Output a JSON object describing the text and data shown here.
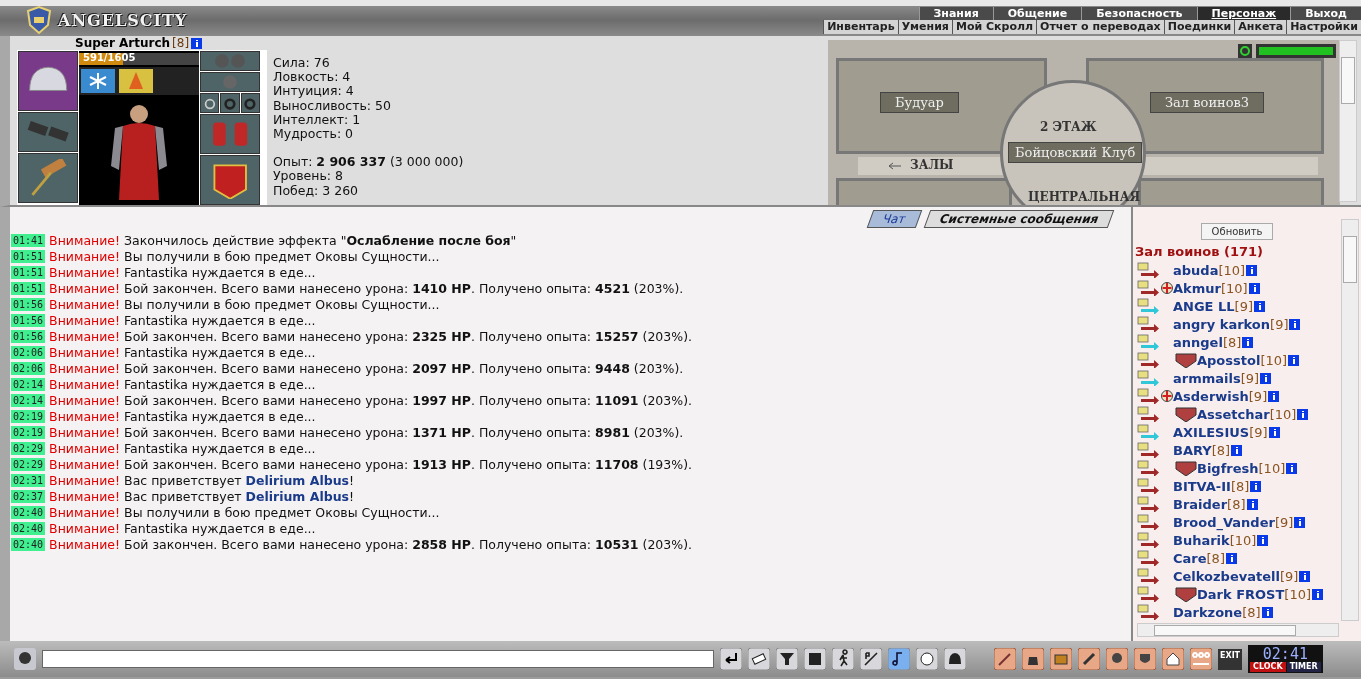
{
  "top_menu": {
    "logo": "ANGELSCITY",
    "primary": [
      {
        "label": "Знания",
        "selected": false
      },
      {
        "label": "Общение",
        "selected": false
      },
      {
        "label": "Безопасность",
        "selected": false
      },
      {
        "label": "Персонаж",
        "selected": true
      },
      {
        "label": "Выход",
        "selected": false
      }
    ],
    "secondary": [
      "Инвентарь",
      "Умения",
      "Мой Скролл",
      "Отчет о переводах",
      "Поединки",
      "Анкета",
      "Настройки"
    ]
  },
  "character": {
    "name": "Super Arturch",
    "level": "[8]",
    "hp": {
      "text": "591/1605",
      "level": 0.37
    },
    "stats": [
      "Сила: 76",
      "Ловкость: 4",
      "Интуиция: 4",
      "Выносливость: 50",
      "Интеллект: 1",
      "Мудрость: 0"
    ],
    "progress": [
      "Опыт: **2 906 337** (3 000 000)",
      "Уровень: 8",
      "Побед: 3 260"
    ]
  },
  "map": {
    "rooms": [
      "Будуар",
      "Зал воинов3"
    ],
    "floor": "2 ЭТАЖ",
    "club": "Бойцовский Клуб",
    "exit": "ЗАЛЫ",
    "bottom": "ЦЕНТРАЛЬНАЯ"
  },
  "chat": {
    "tabs": [
      {
        "label": "Чат",
        "selected": true
      },
      {
        "label": "Системные сообщения",
        "selected": false
      }
    ],
    "messages": [
      {
        "time": "01:41",
        "label": "Внимание!",
        "kind": "info",
        "text": "Закончилось действие эффекта \"**Ослабление после боя**\""
      },
      {
        "time": "01:51",
        "label": "Внимание!",
        "kind": "info",
        "text": "Вы получили в бою предмет Оковы Сущности..."
      },
      {
        "time": "01:51",
        "label": "Внимание!",
        "kind": "info",
        "text": "Fantastika нуждается в еде..."
      },
      {
        "time": "01:51",
        "label": "Внимание!",
        "kind": "info",
        "text": "Бой закончен. Всего вами нанесено урона: **1410 HP**. Получено опыта: **4521** (203%)."
      },
      {
        "time": "01:56",
        "label": "Внимание!",
        "kind": "info",
        "text": "Вы получили в бою предмет Оковы Сущности..."
      },
      {
        "time": "01:56",
        "label": "Внимание!",
        "kind": "info",
        "text": "Fantastika нуждается в еде..."
      },
      {
        "time": "01:56",
        "label": "Внимание!",
        "kind": "info",
        "text": "Бой закончен. Всего вами нанесено урона: **2325 HP**. Получено опыта: **15257** (203%)."
      },
      {
        "time": "02:06",
        "label": "Внимание!",
        "kind": "info",
        "text": "Fantastika нуждается в еде..."
      },
      {
        "time": "02:06",
        "label": "Внимание!",
        "kind": "info",
        "text": "Бой закончен. Всего вами нанесено урона: **2097 HP**. Получено опыта: **9448** (203%)."
      },
      {
        "time": "02:14",
        "label": "Внимание!",
        "kind": "info",
        "text": "Fantastika нуждается в еде..."
      },
      {
        "time": "02:14",
        "label": "Внимание!",
        "kind": "info",
        "text": "Бой закончен. Всего вами нанесено урона: **1997 HP**. Получено опыта: **11091** (203%)."
      },
      {
        "time": "02:19",
        "label": "Внимание!",
        "kind": "info",
        "text": "Fantastika нуждается в еде..."
      },
      {
        "time": "02:19",
        "label": "Внимание!",
        "kind": "info",
        "text": "Бой закончен. Всего вами нанесено урона: **1371 HP**. Получено опыта: **8981** (203%)."
      },
      {
        "time": "02:29",
        "label": "Внимание!",
        "kind": "info",
        "text": "Fantastika нуждается в еде..."
      },
      {
        "time": "02:29",
        "label": "Внимание!",
        "kind": "info",
        "text": "Бой закончен. Всего вами нанесено урона: **1913 HP**. Получено опыта: **11708** (193%)."
      },
      {
        "time": "02:31",
        "label": "Внимание!",
        "kind": "greeting",
        "text": "Вас приветствует **Delirium Albus**!"
      },
      {
        "time": "02:37",
        "label": "Внимание!",
        "kind": "greeting",
        "text": "Вас приветствует **Delirium Albus**!"
      },
      {
        "time": "02:40",
        "label": "Внимание!",
        "kind": "info",
        "text": "Вы получили в бою предмет Оковы Сущности..."
      },
      {
        "time": "02:40",
        "label": "Внимание!",
        "kind": "info",
        "text": "Fantastika нуждается в еде..."
      },
      {
        "time": "02:40",
        "label": "Внимание!",
        "kind": "info",
        "text": "Бой закончен. Всего вами нанесено урона: **2858 HP**. Получено опыта: **10531** (203%)."
      }
    ]
  },
  "players": {
    "refresh": "Обновить",
    "title": "Зал воинов (171)",
    "list": [
      {
        "name": "abuda",
        "level": "[10]",
        "color": "#a02828",
        "kind": "plain"
      },
      {
        "name": "Akmur",
        "level": "[10]",
        "color": "#a02828",
        "kind": "cross"
      },
      {
        "name": "ANGE LL",
        "level": "[9]",
        "color": "#30c8d8",
        "kind": "plain"
      },
      {
        "name": "angry karkon",
        "level": "[9]",
        "color": "#a02828",
        "kind": "plain"
      },
      {
        "name": "anngel",
        "level": "[8]",
        "color": "#30c8d8",
        "kind": "plain"
      },
      {
        "name": "Aposstol",
        "level": "[10]",
        "color": "#a02828",
        "kind": "clan"
      },
      {
        "name": "armmails",
        "level": "[9]",
        "color": "#30c8d8",
        "kind": "plain"
      },
      {
        "name": "Asderwish",
        "level": "[9]",
        "color": "#a02828",
        "kind": "cross"
      },
      {
        "name": "Assetchar",
        "level": "[10]",
        "color": "#a02828",
        "kind": "clan"
      },
      {
        "name": "AXILESIUS",
        "level": "[9]",
        "color": "#30c8d8",
        "kind": "plain"
      },
      {
        "name": "BARY",
        "level": "[8]",
        "color": "#a02828",
        "kind": "plain"
      },
      {
        "name": "Bigfresh",
        "level": "[10]",
        "color": "#a02828",
        "kind": "clan"
      },
      {
        "name": "BITVA-II",
        "level": "[8]",
        "color": "#a02828",
        "kind": "plain"
      },
      {
        "name": "Braider",
        "level": "[8]",
        "color": "#a02828",
        "kind": "plain"
      },
      {
        "name": "Brood_Vander",
        "level": "[9]",
        "color": "#a02828",
        "kind": "plain"
      },
      {
        "name": "Buharik",
        "level": "[10]",
        "color": "#a02828",
        "kind": "plain"
      },
      {
        "name": "Care",
        "level": "[8]",
        "color": "#a02828",
        "kind": "plain"
      },
      {
        "name": "Celkozbevatell",
        "level": "[9]",
        "color": "#a02828",
        "kind": "plain"
      },
      {
        "name": "Dark FROST",
        "level": "[10]",
        "color": "#a02828",
        "kind": "clan"
      },
      {
        "name": "Darkzone",
        "level": "[8]",
        "color": "#a02828",
        "kind": "plain"
      }
    ]
  },
  "bottom_bar": {
    "exit": "EXIT",
    "clock": "02:41",
    "clock_label": "CLOCK",
    "timer_label": "TIMER"
  }
}
